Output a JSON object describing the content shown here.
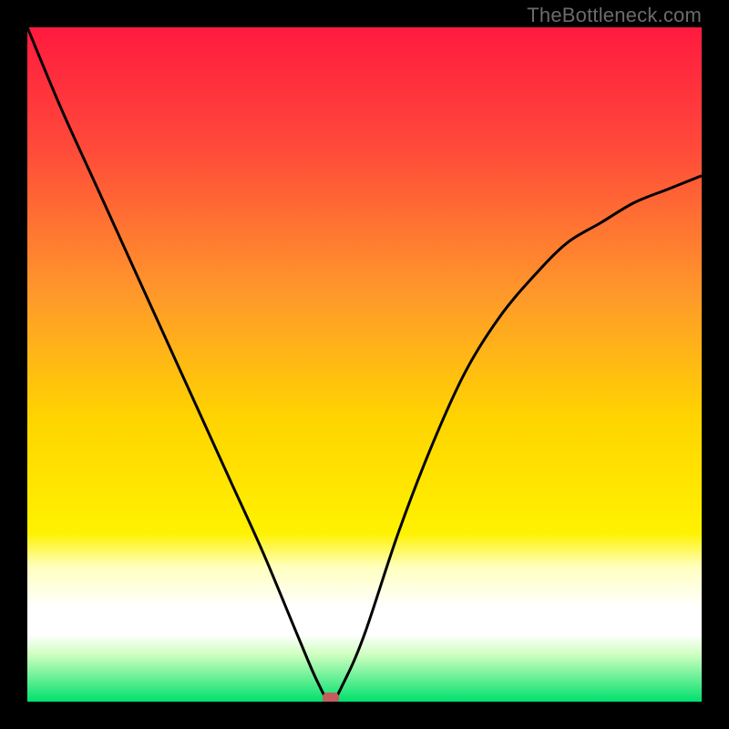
{
  "watermark": "TheBottleneck.com",
  "chart_data": {
    "type": "line",
    "title": "",
    "xlabel": "",
    "ylabel": "",
    "xlim": [
      0,
      1
    ],
    "ylim": [
      0,
      1
    ],
    "grid": false,
    "legend": false,
    "background": {
      "top_color": "#ff1a3f",
      "mid_color": "#ffd400",
      "bottom_color": "#00e06c",
      "white_band_start": 0.8,
      "white_band_end": 0.9
    },
    "series": [
      {
        "name": "bottleneck-curve",
        "x": [
          0.0,
          0.05,
          0.1,
          0.15,
          0.2,
          0.25,
          0.3,
          0.35,
          0.4,
          0.43,
          0.45,
          0.47,
          0.5,
          0.55,
          0.6,
          0.65,
          0.7,
          0.75,
          0.8,
          0.85,
          0.9,
          0.95,
          1.0
        ],
        "y": [
          1.0,
          0.88,
          0.77,
          0.66,
          0.55,
          0.44,
          0.33,
          0.22,
          0.1,
          0.03,
          0.0,
          0.03,
          0.1,
          0.25,
          0.38,
          0.49,
          0.57,
          0.63,
          0.68,
          0.71,
          0.74,
          0.76,
          0.78
        ]
      }
    ],
    "minimum_marker": {
      "x": 0.45,
      "y": 0.0
    },
    "annotations": []
  }
}
